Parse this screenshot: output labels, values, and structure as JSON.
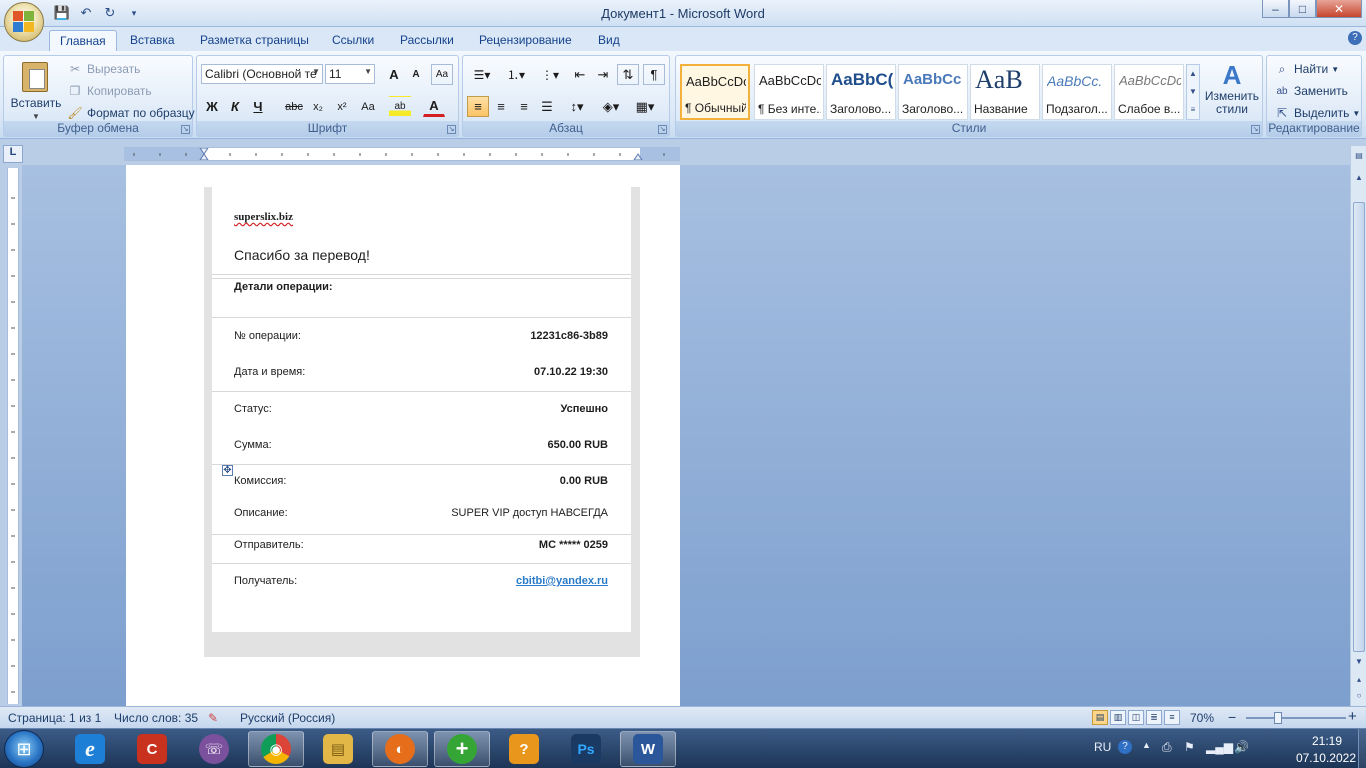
{
  "window": {
    "title": "Документ1 - Microsoft Word",
    "controls": {
      "minimize": "–",
      "maximize": "□",
      "close": "✕"
    }
  },
  "quick_access": {
    "save": "💾",
    "undo": "↶",
    "redo": "↻",
    "customize": "▾"
  },
  "tabs": [
    {
      "label": "Главная",
      "active": true
    },
    {
      "label": "Вставка"
    },
    {
      "label": "Разметка страницы"
    },
    {
      "label": "Ссылки"
    },
    {
      "label": "Рассылки"
    },
    {
      "label": "Рецензирование"
    },
    {
      "label": "Вид"
    }
  ],
  "help": "?",
  "ribbon": {
    "clipboard": {
      "label": "Буфер обмена",
      "paste": "Вставить",
      "cut": "Вырезать",
      "copy": "Копировать",
      "format_painter": "Формат по образцу"
    },
    "font": {
      "label": "Шрифт",
      "font_name": "Calibri (Основной те",
      "font_size": "11",
      "grow": "A",
      "shrink": "A",
      "clear": "Aa",
      "bold": "Ж",
      "italic": "К",
      "underline": "Ч",
      "strike": "abc",
      "subscript": "x₂",
      "superscript": "x²",
      "change_case": "Aa",
      "highlight": "ab",
      "font_color": "A"
    },
    "paragraph": {
      "label": "Абзац"
    },
    "styles": {
      "label": "Стили",
      "tiles": [
        {
          "sample": "AaBbCcDc",
          "name": "¶ Обычный",
          "selected": true
        },
        {
          "sample": "AaBbCcDc",
          "name": "¶ Без инте..."
        },
        {
          "sample": "AaBbC(",
          "name": "Заголово..."
        },
        {
          "sample": "AaBbCc",
          "name": "Заголово..."
        },
        {
          "sample": "AaB",
          "name": "Название"
        },
        {
          "sample": "AaBbCc.",
          "name": "Подзагол..."
        },
        {
          "sample": "AaBbCcDc",
          "name": "Слабое в..."
        }
      ],
      "change_styles": "Изменить стили"
    },
    "editing": {
      "label": "Редактирование",
      "find": "Найти",
      "replace": "Заменить",
      "select": "Выделить"
    }
  },
  "ruler_corner": "L",
  "receipt": {
    "site": "superslix.biz",
    "thanks": "Спасибо за перевод!",
    "details_title": "Детали операции:",
    "rows": [
      {
        "label": "№ операции:",
        "value": "12231c86-3b89"
      },
      {
        "label": "Дата и время:",
        "value": "07.10.22 19:30"
      },
      {
        "label": "Статус:",
        "value": "Успешно"
      },
      {
        "label": "Сумма:",
        "value": "650.00 RUB"
      },
      {
        "label": "Комиссия:",
        "value": "0.00 RUB"
      },
      {
        "label": "Описание:",
        "value": "SUPER VIP доступ НАВСЕГДА"
      },
      {
        "label": "Отправитель:",
        "value": "MC ***** 0259"
      },
      {
        "label": "Получатель:",
        "value": "cbitbi@yandex.ru"
      }
    ]
  },
  "statusbar": {
    "page": "Страница: 1 из 1",
    "words": "Число слов: 35",
    "language": "Русский (Россия)",
    "zoom": "70%",
    "zoom_out": "−",
    "zoom_in": "+"
  },
  "taskbar": {
    "lang": "RU",
    "time": "21:19",
    "date": "07.10.2022",
    "apps": [
      {
        "icon": "ie-icon",
        "glyph": "e",
        "color": "#1e7fd6"
      },
      {
        "icon": "ccleaner-icon",
        "glyph": "C",
        "color": "#c8321e"
      },
      {
        "icon": "viber-icon",
        "glyph": "☏",
        "color": "#7b519d"
      },
      {
        "icon": "chrome-icon",
        "glyph": "◉",
        "color": "#e0b323"
      },
      {
        "icon": "explorer-icon",
        "glyph": "▤",
        "color": "#e2b647"
      },
      {
        "icon": "firefox-icon",
        "glyph": "◐",
        "color": "#e66d1a"
      },
      {
        "icon": "plus-app-icon",
        "glyph": "+",
        "color": "#35a635"
      },
      {
        "icon": "help-app-icon",
        "glyph": "?",
        "color": "#e8961c"
      },
      {
        "icon": "photoshop-icon",
        "glyph": "Ps",
        "color": "#1a3a64"
      },
      {
        "icon": "word-icon",
        "glyph": "W",
        "color": "#2b579a"
      }
    ]
  }
}
